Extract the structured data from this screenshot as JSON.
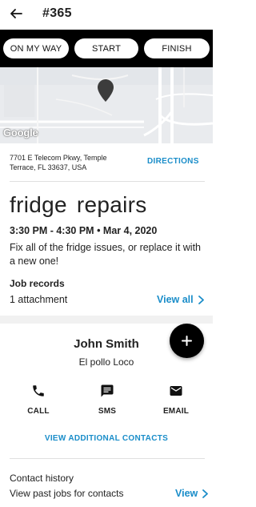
{
  "header": {
    "job_number": "#365"
  },
  "status_buttons": [
    "ON MY WAY",
    "START",
    "FINISH"
  ],
  "map": {
    "logo_text": "Google"
  },
  "location": {
    "address": "7701 E Telecom Pkwy, Temple Terrace, FL 33637, USA",
    "directions_label": "DIRECTIONS"
  },
  "job": {
    "title": "fridge repairs",
    "time": "3:30 PM - 4:30 PM • Mar 4, 2020",
    "description": "Fix all of the fridge issues, or replace it with a new one!"
  },
  "records": {
    "label": "Job records",
    "count": "1 attachment",
    "view_all": "View all"
  },
  "contact": {
    "name": "John Smith",
    "company": "El pollo Loco",
    "actions": [
      "CALL",
      "SMS",
      "EMAIL"
    ],
    "view_additional": "VIEW ADDITIONAL CONTACTS"
  },
  "history": {
    "label": "Contact history",
    "sub": "View past jobs for contacts",
    "view": "View"
  },
  "colors": {
    "accent": "#1a8dc9",
    "status_bar": "#000000",
    "fab": "#000000"
  },
  "icons": [
    "back-arrow-icon",
    "map-pin-icon",
    "chevron-right-icon",
    "plus-icon",
    "phone-icon",
    "sms-icon",
    "email-icon"
  ]
}
